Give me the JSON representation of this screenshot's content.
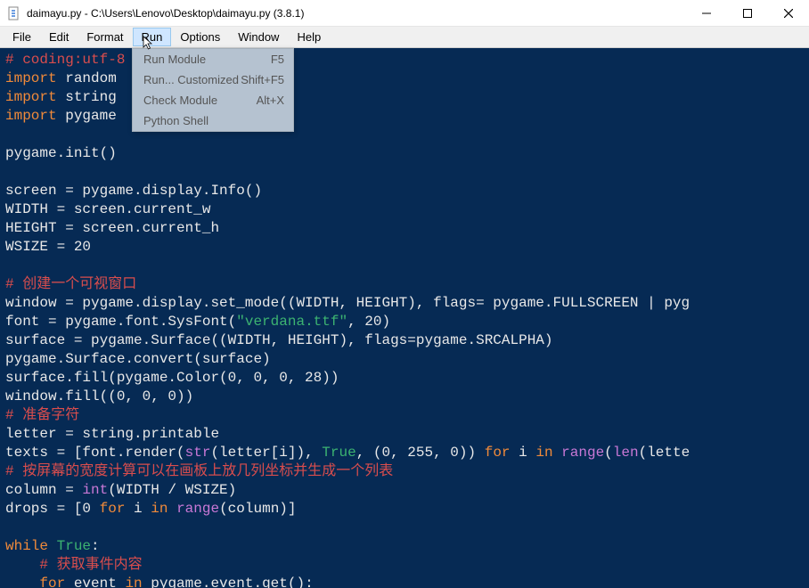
{
  "title": "daimayu.py - C:\\Users\\Lenovo\\Desktop\\daimayu.py (3.8.1)",
  "menu": {
    "file": "File",
    "edit": "Edit",
    "format": "Format",
    "run": "Run",
    "options": "Options",
    "window": "Window",
    "help": "Help"
  },
  "dropdown": {
    "run_module": "Run Module",
    "run_module_key": "F5",
    "run_custom": "Run... Customized",
    "run_custom_key": "Shift+F5",
    "check_module": "Check Module",
    "check_module_key": "Alt+X",
    "python_shell": "Python Shell"
  },
  "code": {
    "l1a": "# coding:utf-8",
    "l2a": "import",
    "l2b": " random",
    "l3a": "import",
    "l3b": " string",
    "l4a": "import",
    "l4b": " pygame",
    "l6": "pygame.init()",
    "l8": "screen = pygame.display.Info()",
    "l9": "WIDTH = screen.current_w",
    "l10": "HEIGHT = screen.current_h",
    "l11": "WSIZE = 20",
    "l13": "# 创建一个可视窗口",
    "l14": "window = pygame.display.set_mode((WIDTH, HEIGHT), flags= pygame.FULLSCREEN | pyg",
    "l15a": "font = pygame.font.SysFont(",
    "l15b": "\"verdana.ttf\"",
    "l15c": ", 20)",
    "l16": "surface = pygame.Surface((WIDTH, HEIGHT), flags=pygame.SRCALPHA)",
    "l17": "pygame.Surface.convert(surface)",
    "l18": "surface.fill(pygame.Color(0, 0, 0, 28))",
    "l19": "window.fill((0, 0, 0))",
    "l20": "# 准备字符",
    "l21": "letter = string.printable",
    "l22a": "texts = [font.render(",
    "l22b": "str",
    "l22c": "(letter[i]), ",
    "l22d": "True",
    "l22e": ", (0, 255, 0)) ",
    "l22f": "for",
    "l22g": " i ",
    "l22h": "in",
    "l22i": " ",
    "l22j": "range",
    "l22k": "(",
    "l22l": "len",
    "l22m": "(lette",
    "l23": "# 按屏幕的宽度计算可以在画板上放几列坐标并生成一个列表",
    "l24a": "column = ",
    "l24b": "int",
    "l24c": "(WIDTH / WSIZE)",
    "l25a": "drops = [0 ",
    "l25b": "for",
    "l25c": " i ",
    "l25d": "in",
    "l25e": " ",
    "l25f": "range",
    "l25g": "(column)]",
    "l27a": "while",
    "l27b": " ",
    "l27c": "True",
    "l27d": ":",
    "l28": "    # 获取事件内容",
    "l29a": "    ",
    "l29b": "for",
    "l29c": " event ",
    "l29d": "in",
    "l29e": " pygame.event.get():"
  }
}
